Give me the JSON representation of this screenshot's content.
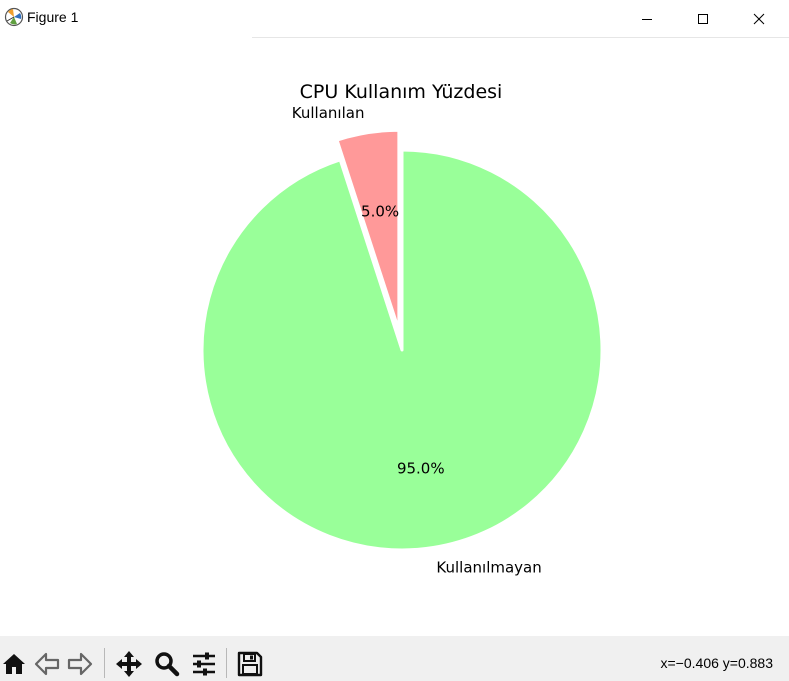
{
  "window": {
    "title": "Figure 1"
  },
  "toolbar": {
    "coords": "x=−0.406 y=0.883"
  },
  "chart_data": {
    "type": "pie",
    "title": "CPU Kullanım Yüzdesi",
    "labels": [
      "Kullanılan",
      "Kullanılmayan"
    ],
    "values": [
      5.0,
      95.0
    ],
    "autopct": [
      "5.0%",
      "95.0%"
    ],
    "colors": [
      "#ff9999",
      "#99ff99"
    ],
    "explode": [
      0.1,
      0
    ],
    "start_angle": 90,
    "legend": "none"
  }
}
